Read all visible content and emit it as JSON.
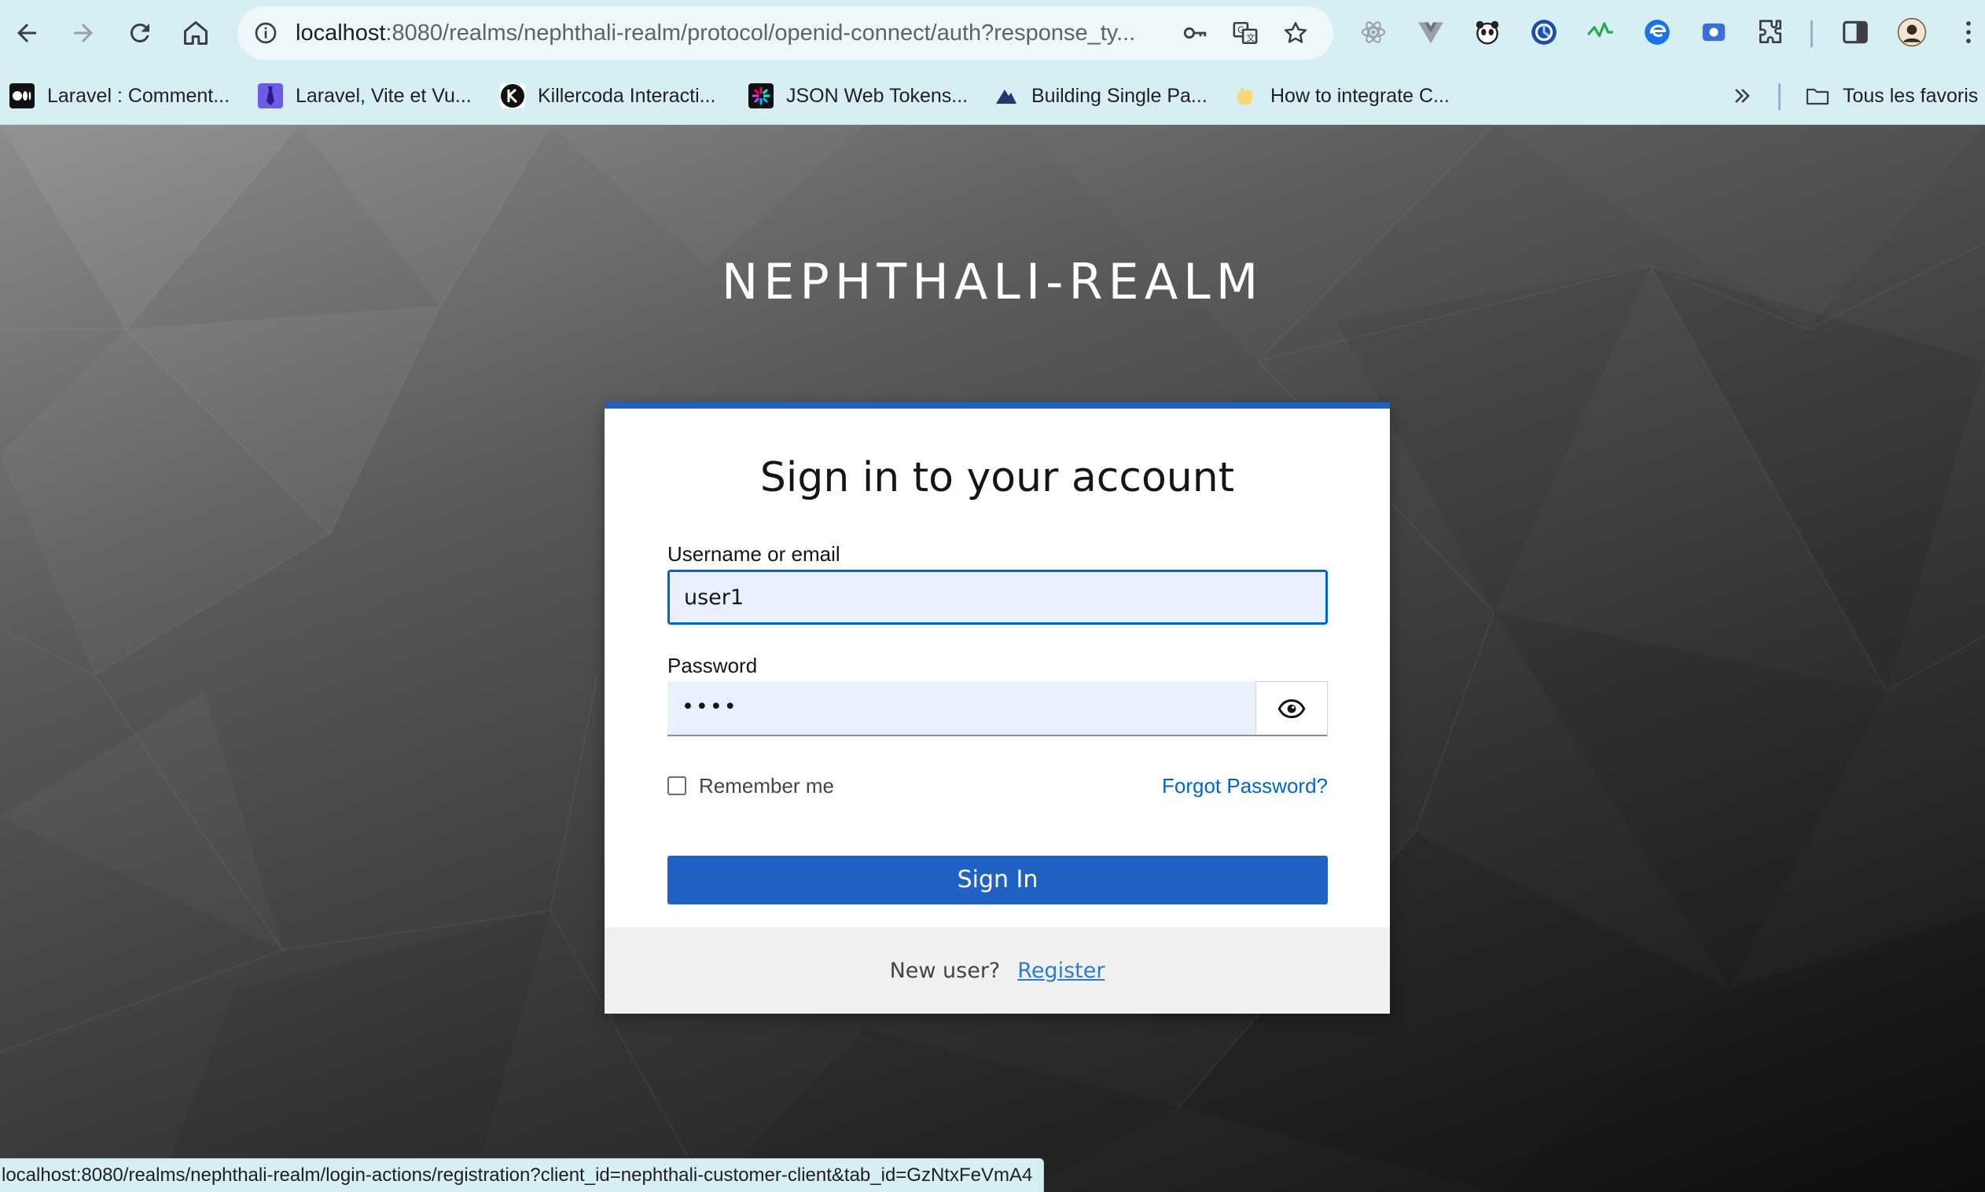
{
  "browser": {
    "url_host": "localhost",
    "url_rest": ":8080/realms/nephthali-realm/protocol/openid-connect/auth?response_ty...",
    "bookmarks": [
      {
        "label": "Laravel : Comment..."
      },
      {
        "label": "Laravel, Vite et Vu..."
      },
      {
        "label": "Killercoda Interacti..."
      },
      {
        "label": "JSON Web Tokens..."
      },
      {
        "label": "Building Single Pa..."
      },
      {
        "label": "How to integrate C..."
      }
    ],
    "all_bookmarks_label": "Tous les favoris",
    "status_url": "localhost:8080/realms/nephthali-realm/login-actions/registration?client_id=nephthali-customer-client&tab_id=GzNtxFeVmA4"
  },
  "realm": {
    "title": "NEPHTHALI-REALM"
  },
  "login": {
    "heading": "Sign in to your account",
    "username_label": "Username or email",
    "username_value": "user1",
    "password_label": "Password",
    "password_value": "••••",
    "remember_label": "Remember me",
    "remember_checked": false,
    "forgot_link": "Forgot Password?",
    "submit_label": "Sign In",
    "new_user_text": "New user?",
    "register_link": "Register"
  },
  "colors": {
    "primary": "#1f62c4",
    "link": "#0066cc",
    "input_bg": "#e8f0fe",
    "chrome_bg": "#d6eef4"
  }
}
